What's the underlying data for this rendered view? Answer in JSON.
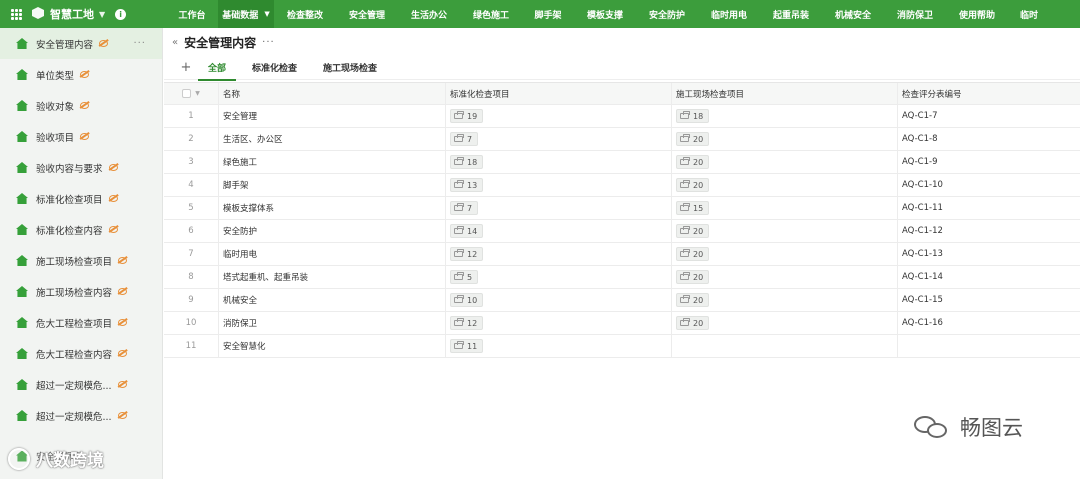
{
  "app": {
    "brand": "智慧工地",
    "info_glyph": "i"
  },
  "nav": [
    "工作台",
    "基础数据",
    "检查整改",
    "安全管理",
    "生活办公",
    "绿色施工",
    "脚手架",
    "模板支撑",
    "安全防护",
    "临时用电",
    "起重吊装",
    "机械安全",
    "消防保卫",
    "使用帮助",
    "临时"
  ],
  "nav_active_index": 1,
  "sidebar": {
    "items": [
      "安全管理内容",
      "单位类型",
      "验收对象",
      "验收项目",
      "验收内容与要求",
      "标准化检查项目",
      "标准化检查内容",
      "施工现场检查项目",
      "施工现场检查内容",
      "危大工程检查项目",
      "危大工程检查内容",
      "超过一定规模危...",
      "超过一定规模危..."
    ],
    "active_index": 0,
    "partial_item": "安全帽佩戴",
    "more_glyph": "···"
  },
  "main": {
    "title": "安全管理内容",
    "title_more": "···",
    "collapse_glyph": "«",
    "add_tab_glyph": "+",
    "tabs": [
      "全部",
      "标准化检查",
      "施工现场检查"
    ],
    "active_tab": 0
  },
  "table": {
    "columns": [
      "名称",
      "标准化检查项目",
      "施工现场检查项目",
      "检查评分表编号"
    ],
    "rows": [
      {
        "no": "1",
        "name": "安全管理",
        "std": "19",
        "site": "18",
        "code": "AQ-C1-7"
      },
      {
        "no": "2",
        "name": "生活区、办公区",
        "std": "7",
        "site": "20",
        "code": "AQ-C1-8"
      },
      {
        "no": "3",
        "name": "绿色施工",
        "std": "18",
        "site": "20",
        "code": "AQ-C1-9"
      },
      {
        "no": "4",
        "name": "脚手架",
        "std": "13",
        "site": "20",
        "code": "AQ-C1-10"
      },
      {
        "no": "5",
        "name": "模板支撑体系",
        "std": "7",
        "site": "15",
        "code": "AQ-C1-11"
      },
      {
        "no": "6",
        "name": "安全防护",
        "std": "14",
        "site": "20",
        "code": "AQ-C1-12"
      },
      {
        "no": "7",
        "name": "临时用电",
        "std": "12",
        "site": "20",
        "code": "AQ-C1-13"
      },
      {
        "no": "8",
        "name": "塔式起重机、起重吊装",
        "std": "5",
        "site": "20",
        "code": "AQ-C1-14"
      },
      {
        "no": "9",
        "name": "机械安全",
        "std": "10",
        "site": "20",
        "code": "AQ-C1-15"
      },
      {
        "no": "10",
        "name": "消防保卫",
        "std": "12",
        "site": "20",
        "code": "AQ-C1-16"
      },
      {
        "no": "11",
        "name": "安全智慧化",
        "std": "11",
        "site": "",
        "code": ""
      }
    ]
  },
  "watermarks": {
    "right": "畅图云",
    "left": "八数跨境"
  },
  "colors": {
    "brand_green": "#3c9d3c",
    "active_nav": "#2f8a2f",
    "icon_green": "#36a03a",
    "eye_orange": "#e8903a"
  }
}
